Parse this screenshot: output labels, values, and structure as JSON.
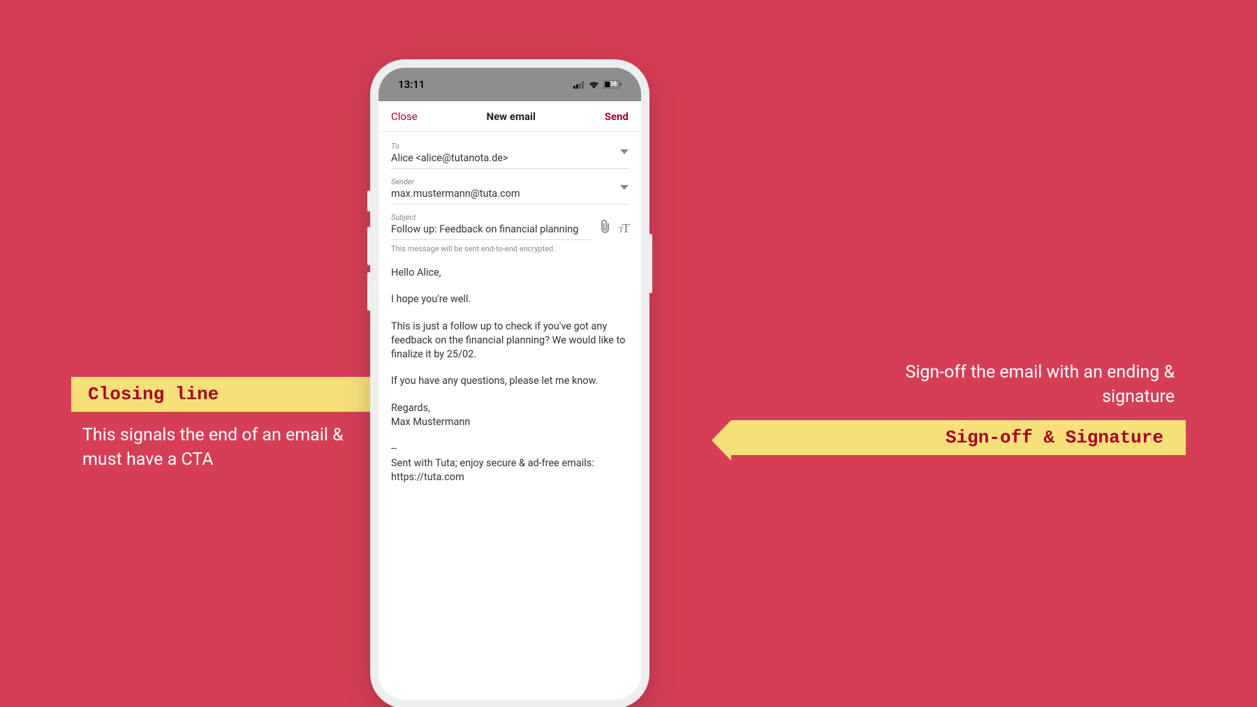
{
  "statusbar": {
    "time": "13:11",
    "battery": "38"
  },
  "header": {
    "close": "Close",
    "title": "New email",
    "send": "Send"
  },
  "fields": {
    "to_label": "To",
    "to_value": "Alice <alice@tutanota.de>",
    "sender_label": "Sender",
    "sender_value": "max.mustermann@tuta.com",
    "subject_label": "Subject",
    "subject_value": "Follow up: Feedback on financial planning"
  },
  "encrypt_note": "This message will be sent end-to-end encrypted.",
  "body": {
    "p1": "Hello Alice,",
    "p2": "I hope you're well.",
    "p3": "This is just a follow up to check if you've got any feedback on the financial planning? We would like to finalize it by 25/02.",
    "p4": "If you have any questions, please let me know.",
    "p5": "Regards,\nMax Mustermann",
    "sig": "--\nSent with Tuta; enjoy secure & ad-free emails: https://tuta.com"
  },
  "callouts": {
    "left_title": "Closing line",
    "left_caption": "This signals the end of an email & must have a CTA",
    "right_title": "Sign-off & Signature",
    "right_caption": "Sign-off the email with an ending & signature"
  }
}
